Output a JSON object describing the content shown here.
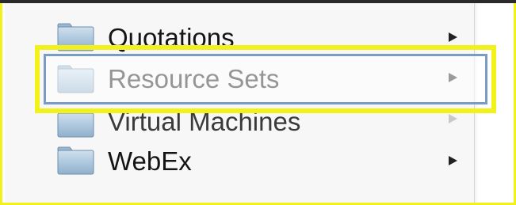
{
  "menu": {
    "items": [
      {
        "label": "Quotations",
        "has_submenu": true,
        "state": "partial"
      },
      {
        "label": "Resource Sets",
        "has_submenu": true,
        "state": "selected"
      },
      {
        "label": "Virtual Machines",
        "has_submenu": true,
        "state": "occluded"
      },
      {
        "label": "WebEx",
        "has_submenu": true,
        "state": "normal"
      }
    ]
  },
  "icons": {
    "folder": "folder-icon",
    "submenu": "submenu-arrow-icon"
  },
  "colors": {
    "highlight": "#f2f21a",
    "selection_border": "#7a9bc4",
    "folder_fill": "#a8c4dc"
  }
}
